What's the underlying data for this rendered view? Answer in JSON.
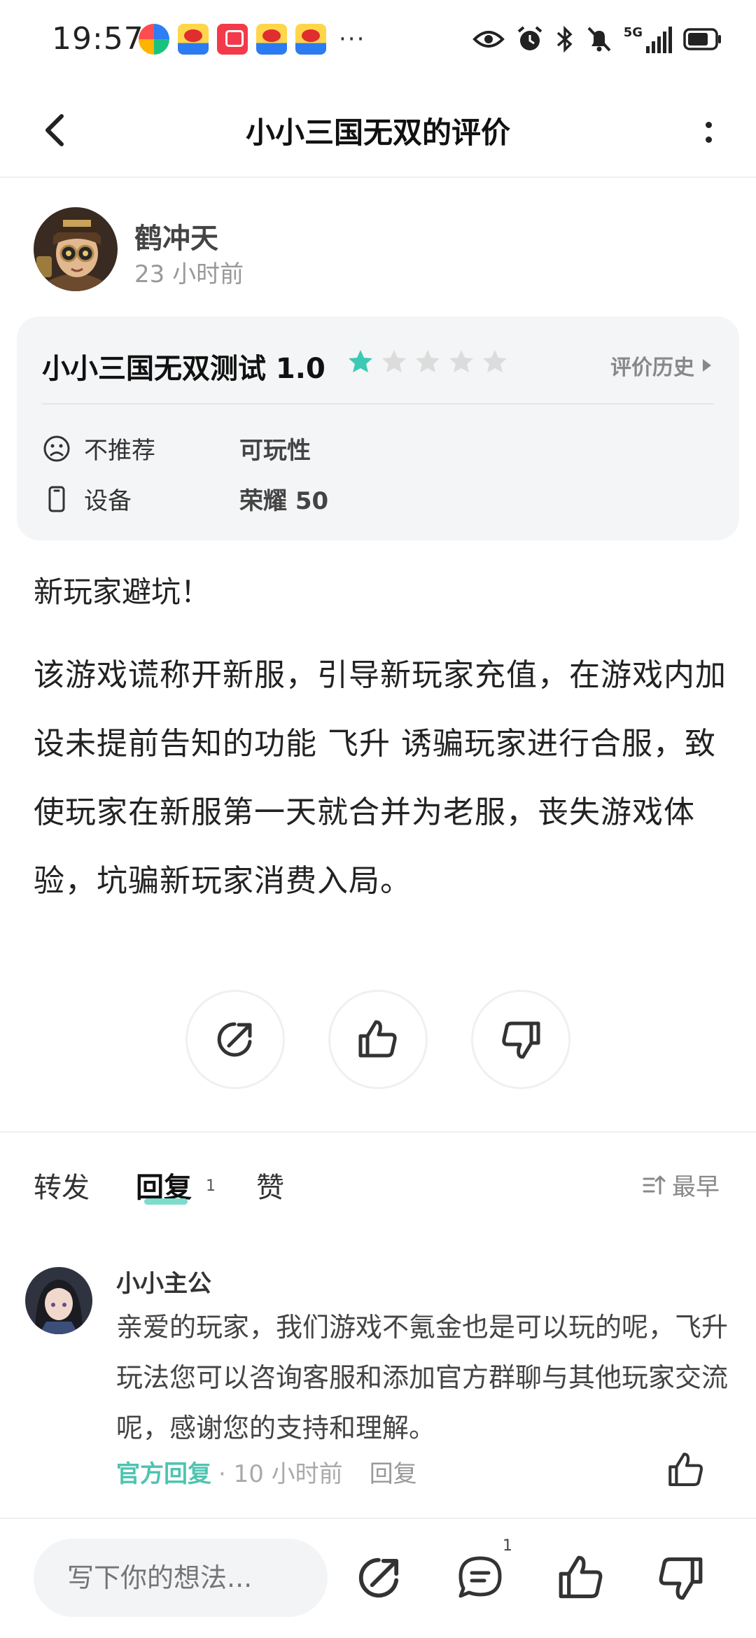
{
  "status_bar": {
    "time": "19:57",
    "more": "···",
    "network": "5G"
  },
  "header": {
    "title": "小小三国无双的评价"
  },
  "author": {
    "name": "鹤冲天",
    "time": "23 小时前"
  },
  "game_card": {
    "title": "小小三国无双测试 1.0",
    "rating": 1,
    "rating_max": 5,
    "history_link": "评价历史",
    "recommend_label": "不推荐",
    "recommend_value": "可玩性",
    "device_label": "设备",
    "device_value": "荣耀 50"
  },
  "review": {
    "title": "新玩家避坑！",
    "body": "该游戏谎称开新服，引导新玩家充值，在游戏内加设未提前告知的功能 飞升 诱骗玩家进行合服，致使玩家在新服第一天就合并为老服，丧失游戏体验，坑骗新玩家消费入局。"
  },
  "tabs": {
    "forward": "转发",
    "reply": "回复",
    "reply_count": "1",
    "like": "赞",
    "sort": "最早"
  },
  "reply": {
    "name": "小小主公",
    "text": "亲爱的玩家，我们游戏不氪金也是可以玩的呢，飞升玩法您可以咨询客服和添加官方群聊与其他玩家交流呢，感谢您的支持和理解。",
    "official_tag": "官方回复",
    "time": "· 10 小时前",
    "reply_action": "回复"
  },
  "bottom_bar": {
    "placeholder": "写下你的想法...",
    "comment_count": "1"
  },
  "colors": {
    "accent": "#4fc4b0",
    "star_on": "#3cc9b5",
    "star_off": "#dcdcdc"
  }
}
